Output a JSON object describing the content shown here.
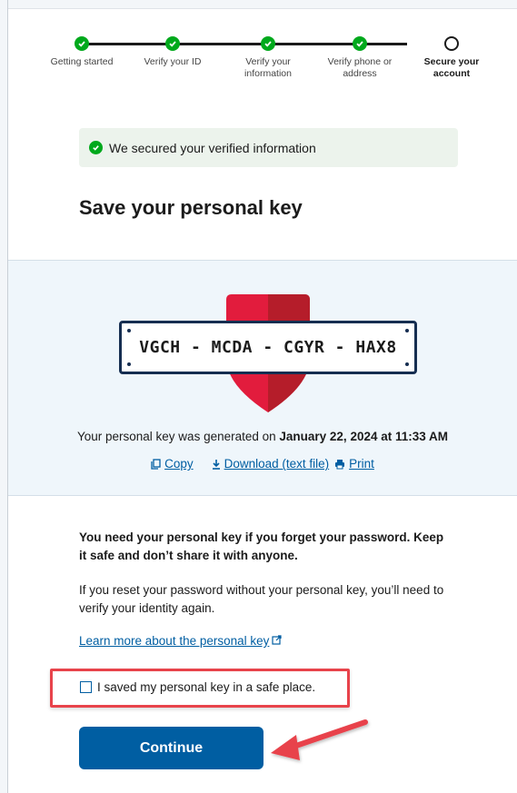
{
  "steps": [
    {
      "label": "Getting started",
      "status": "done"
    },
    {
      "label": "Verify your ID",
      "status": "done"
    },
    {
      "label": "Verify your information",
      "status": "done"
    },
    {
      "label": "Verify phone or address",
      "status": "done"
    },
    {
      "label": "Secure your account",
      "status": "current"
    }
  ],
  "alert": {
    "text": "We secured your verified information"
  },
  "page_title": "Save your personal key",
  "key": {
    "value": "VGCH - MCDA - CGYR - HAX8",
    "generated_prefix": "Your personal key was generated on ",
    "generated_date": "January 22, 2024 at 11:33 AM"
  },
  "actions": {
    "copy": "Copy",
    "download": "Download (text file)",
    "print": "Print"
  },
  "warning": "You need your personal key if you forget your password. Keep it safe and don’t share it with anyone.",
  "info": "If you reset your password without your personal key, you’ll need to verify your identity again.",
  "learn_more": "Learn more about the personal key",
  "checkbox_label": "I saved my personal key in a safe place.",
  "continue_label": "Continue",
  "colors": {
    "primary": "#005ea2",
    "success": "#00a91c",
    "highlight": "#e8434b",
    "shield": "#e21c3d"
  }
}
